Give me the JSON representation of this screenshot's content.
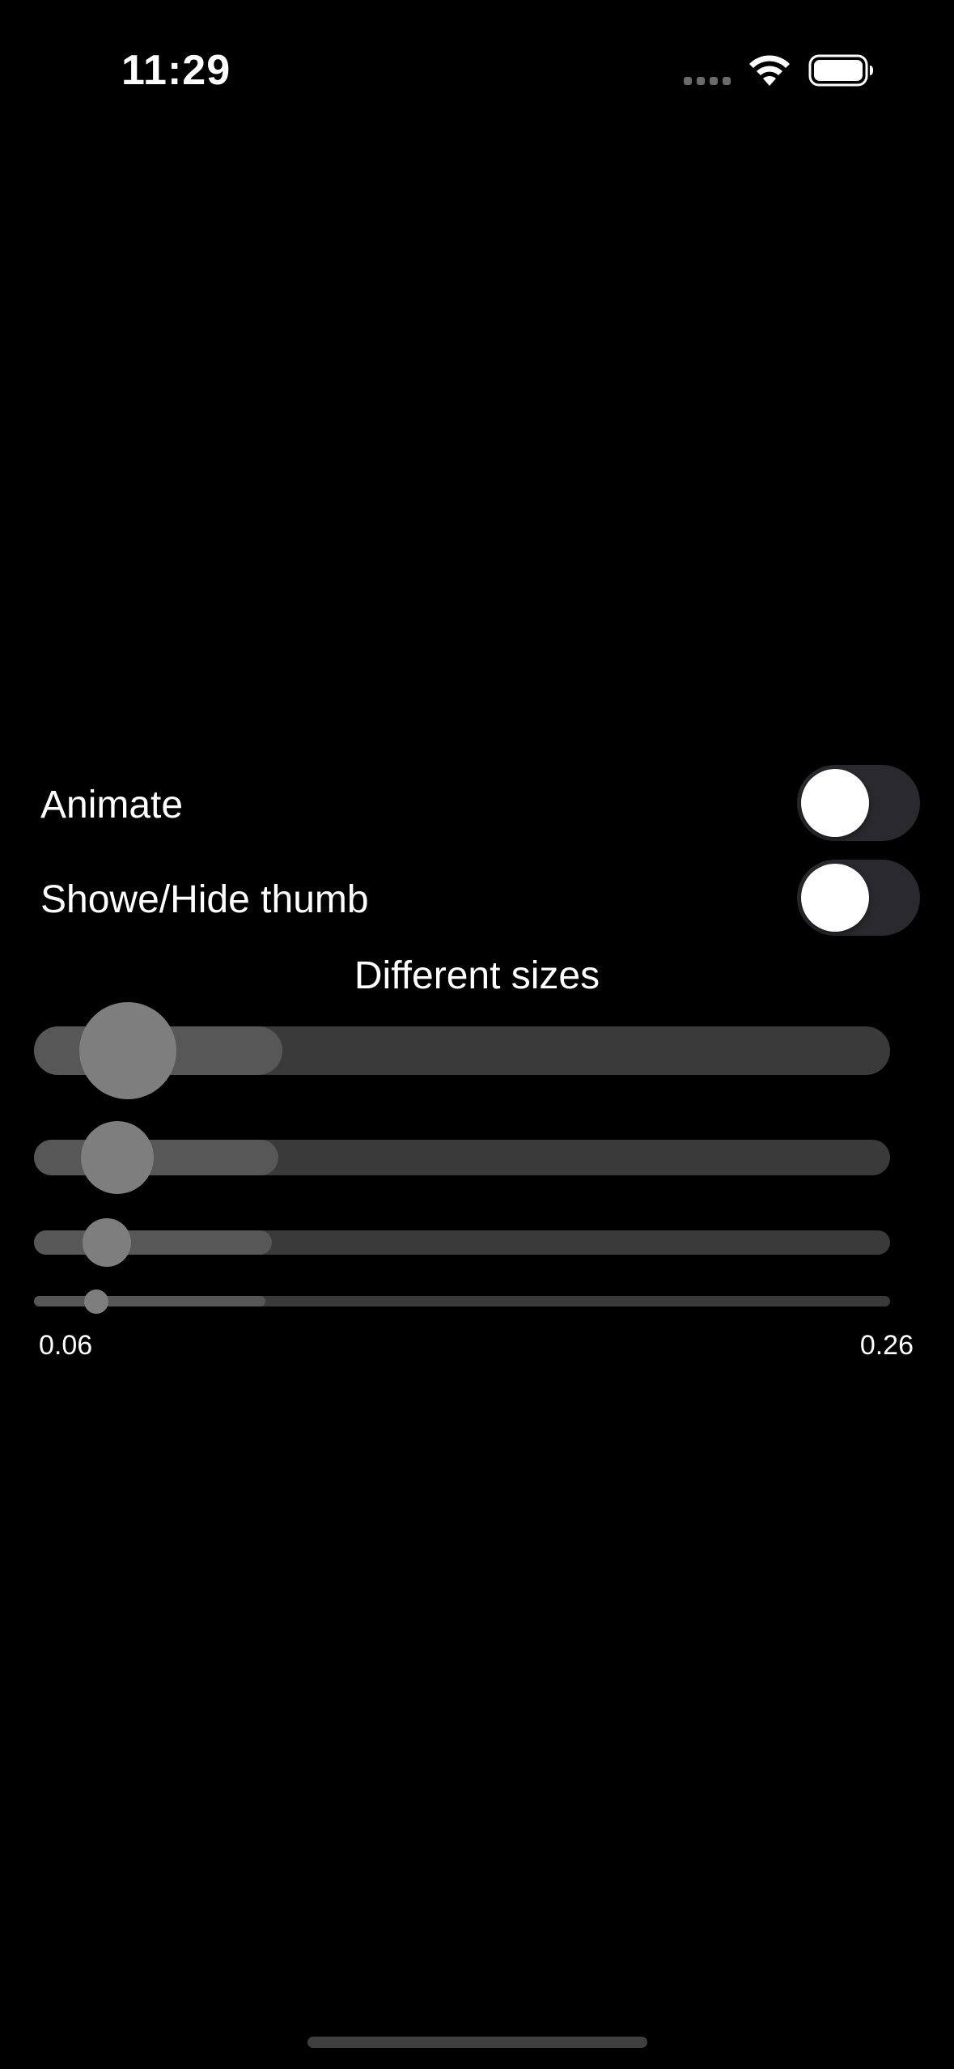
{
  "status_bar": {
    "time": "11:29"
  },
  "controls": {
    "animate": {
      "label": "Animate",
      "on": false
    },
    "show_hide_thumb": {
      "label": "Showe/Hide thumb",
      "on": false
    }
  },
  "sizes_section": {
    "title": "Different sizes",
    "sliders": [
      {
        "name": "slider-large",
        "value": 0.06,
        "buffer": 0.29
      },
      {
        "name": "slider-medium",
        "value": 0.06,
        "buffer": 0.285
      },
      {
        "name": "slider-small",
        "value": 0.06,
        "buffer": 0.278
      },
      {
        "name": "slider-tiny",
        "value": 0.06,
        "buffer": 0.27
      }
    ],
    "min_label": "0.06",
    "max_label": "0.26"
  },
  "colors": {
    "background": "#000000",
    "track": "#3a3a3a",
    "fill": "#575757",
    "thumb": "#7e7e7e",
    "toggle_off": "#2a2a2e",
    "knob": "#ffffff"
  }
}
